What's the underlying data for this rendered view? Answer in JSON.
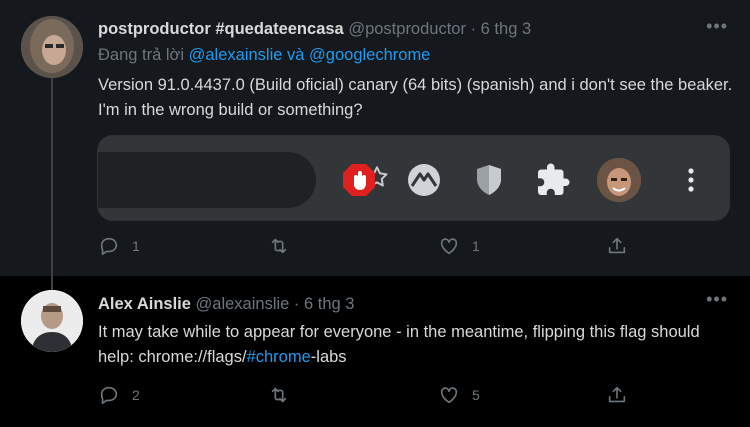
{
  "tweet1": {
    "name": "postproductor #quedateencasa",
    "handle": "@postproductor",
    "sep": "·",
    "date": "6 thg 3",
    "replying_prefix": "Đang trả lời",
    "reply_to_1": "@alexainslie",
    "reply_and": "và",
    "reply_to_2": "@googlechrome",
    "text": "Version 91.0.4437.0 (Build oficial) canary (64 bits) (spanish) and i don't see the beaker. I'm in the wrong build or something?",
    "replies": "1",
    "retweets": "",
    "likes": "1",
    "media_icons": [
      "star-icon",
      "stop-hand-extension-icon",
      "vpn-extension-icon",
      "shield-extension-icon",
      "puzzle-icon",
      "profile-face-icon",
      "kebab-menu-icon"
    ]
  },
  "tweet2": {
    "name": "Alex Ainslie",
    "handle": "@alexainslie",
    "sep": "·",
    "date": "6 thg 3",
    "text_before": "It may take while to appear for everyone - in the meantime, flipping this flag should help: chrome://flags/",
    "hashtag": "#chrome",
    "text_after": "-labs",
    "replies": "2",
    "retweets": "",
    "likes": "5"
  },
  "more_label": "•••",
  "colors": {
    "accent": "#1d9bf0",
    "muted": "#6e767d",
    "text": "#d9d9d9",
    "bg": "#000000",
    "highlight_bg": "#15181c"
  }
}
